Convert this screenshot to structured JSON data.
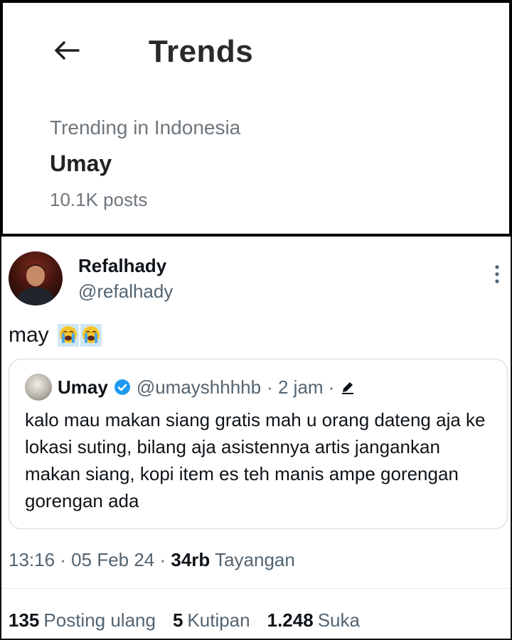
{
  "header": {
    "title": "Trends",
    "back_icon": "arrow-left-icon"
  },
  "trend": {
    "context": "Trending in Indonesia",
    "name": "Umay",
    "count": "10.1K posts"
  },
  "tweet": {
    "author": {
      "display_name": "Refalhady",
      "handle": "@refalhady"
    },
    "more_icon": "more-vertical-icon",
    "text": "may",
    "emojis": [
      "loudly-crying-face-emoji",
      "loudly-crying-face-emoji"
    ],
    "quote": {
      "name": "Umay",
      "verified_icon": "verified-badge-icon",
      "handle": "@umayshhhhb",
      "time": "· 2 jam ·",
      "edit_icon": "pencil-icon",
      "text": "kalo mau makan siang gratis mah u orang dateng aja ke lokasi suting, bilang aja asistennya artis jangankan makan siang, kopi item es teh manis ampe gorengan gorengan ada"
    },
    "meta": {
      "datetime": "13:16 · 05 Feb 24 ·",
      "views_count": "34rb",
      "views_label": "Tayangan"
    },
    "stats": {
      "reposts_count": "135",
      "reposts_label": "Posting ulang",
      "quotes_count": "5",
      "quotes_label": "Kutipan",
      "likes_count": "1.248",
      "likes_label": "Suka"
    }
  },
  "colors": {
    "verified": "#1d9bf0",
    "secondary_text": "#536471",
    "primary_text": "#0f1419"
  }
}
